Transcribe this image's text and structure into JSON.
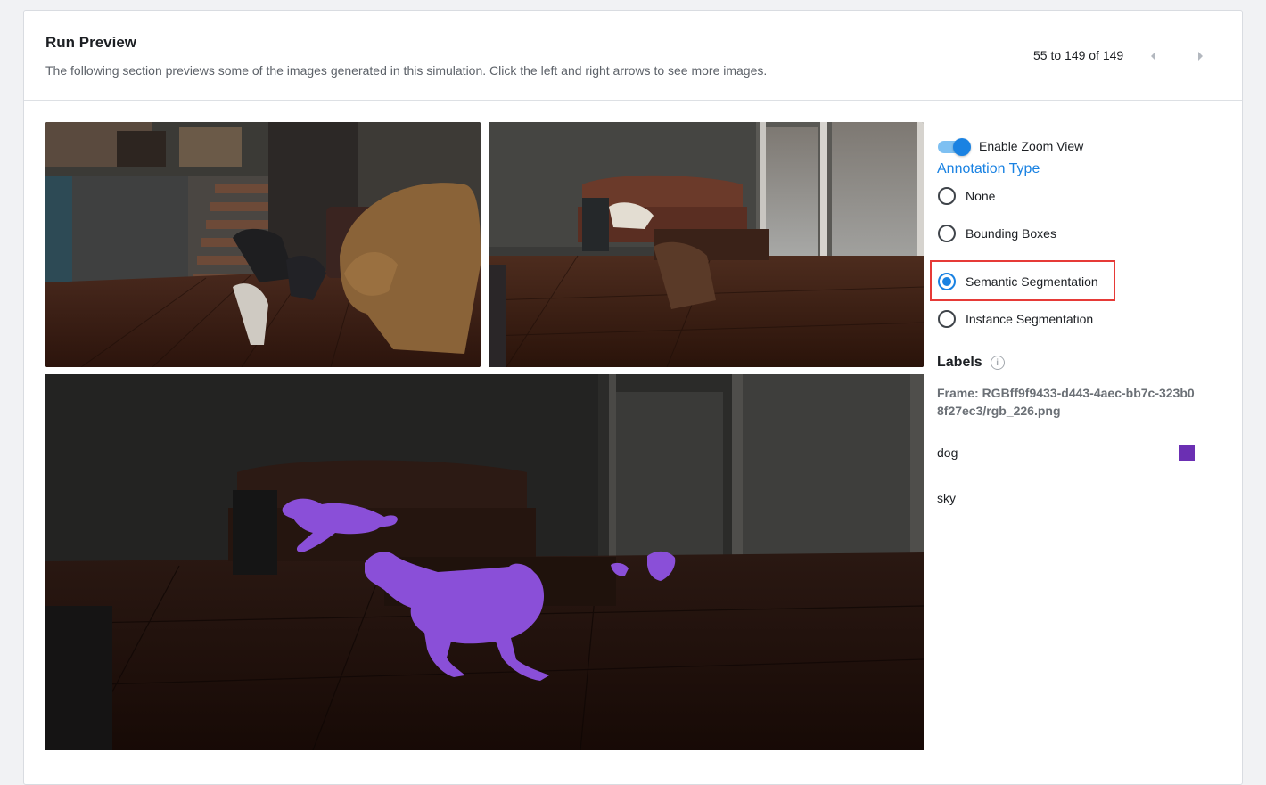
{
  "header": {
    "title": "Run Preview",
    "subtitle": "The following section previews some of the images generated in this simulation. Click the left and right arrows to see more images."
  },
  "pager": {
    "text": "55 to 149 of 149",
    "prev_icon": "caret-left-icon",
    "next_icon": "caret-right-icon"
  },
  "controls": {
    "zoom_toggle_label": "Enable Zoom View",
    "zoom_enabled": true,
    "annotation_type_title": "Annotation Type",
    "annotation_options": [
      {
        "label": "None",
        "selected": false
      },
      {
        "label": "Bounding Boxes",
        "selected": false
      },
      {
        "label": "Semantic Segmentation",
        "selected": true
      },
      {
        "label": "Instance Segmentation",
        "selected": false
      }
    ]
  },
  "labels_panel": {
    "title": "Labels",
    "info_icon": "info-icon",
    "frame": "Frame: RGBff9f9433-d443-4aec-bb7c-323b08f27ec3/rgb_226.png",
    "legend": [
      {
        "label": "dog",
        "color": "#6b2fb3"
      },
      {
        "label": "sky",
        "color": ""
      }
    ]
  },
  "colors": {
    "accent": "#1a82e2",
    "highlight": "#e63a37",
    "segmentation_dog": "#8a4fd8"
  }
}
